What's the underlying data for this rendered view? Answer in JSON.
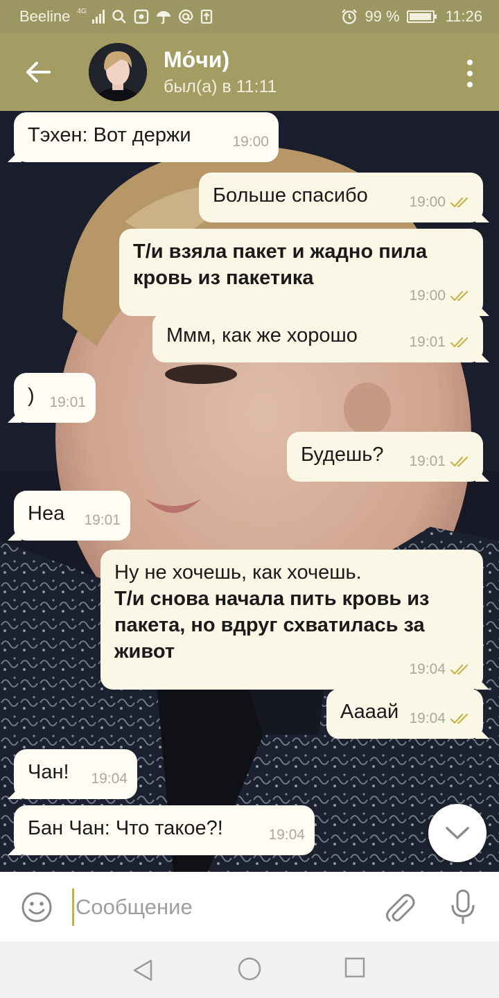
{
  "status_bar": {
    "carrier": "Beeline",
    "network": "4G",
    "battery": "99 %",
    "battery_level": 0.99,
    "time": "11:26"
  },
  "header": {
    "contact_name": "Мо́чи)",
    "last_seen": "был(а) в 11:11"
  },
  "messages": [
    {
      "dir": "in",
      "lines": [
        {
          "text": "Тэхен: Вот держи",
          "bold": false
        }
      ],
      "time": "19:00"
    },
    {
      "dir": "out",
      "lines": [
        {
          "text": "Больше спасибо",
          "bold": false
        }
      ],
      "time": "19:00",
      "read": true
    },
    {
      "dir": "out",
      "lines": [
        {
          "text": "Т/и взяла пакет и жадно пила",
          "bold": true
        },
        {
          "text": "кровь из пакетика",
          "bold": true
        }
      ],
      "time": "19:00",
      "read": true
    },
    {
      "dir": "out",
      "lines": [
        {
          "text": "Ммм, как же хорошо",
          "bold": false
        }
      ],
      "time": "19:01",
      "read": true
    },
    {
      "dir": "in",
      "lines": [
        {
          "text": ")",
          "bold": false
        }
      ],
      "time": "19:01"
    },
    {
      "dir": "out",
      "lines": [
        {
          "text": "Будешь?",
          "bold": false
        }
      ],
      "time": "19:01",
      "read": true
    },
    {
      "dir": "in",
      "lines": [
        {
          "text": "Неа",
          "bold": false
        }
      ],
      "time": "19:01"
    },
    {
      "dir": "out",
      "lines": [
        {
          "text": "Ну не хочешь, как хочешь.",
          "bold": false
        },
        {
          "text": "Т/и снова начала пить кровь из",
          "bold": true
        },
        {
          "text": "пакета, но вдруг схватилась за",
          "bold": true
        },
        {
          "text": "живот",
          "bold": true
        }
      ],
      "time": "19:04",
      "read": true
    },
    {
      "dir": "out",
      "lines": [
        {
          "text": "Аааай",
          "bold": false
        }
      ],
      "time": "19:04",
      "read": true
    },
    {
      "dir": "in",
      "lines": [
        {
          "text": "Чан!",
          "bold": false
        }
      ],
      "time": "19:04"
    },
    {
      "dir": "in",
      "lines": [
        {
          "text": "Бан Чан: Что такое?!",
          "bold": false
        }
      ],
      "time": "19:04"
    }
  ],
  "input": {
    "placeholder": "Сообщение",
    "value": ""
  },
  "icons": {
    "back": "arrow-left-icon",
    "menu": "more-vertical-icon",
    "emoji": "smiley-icon",
    "attach": "paperclip-icon",
    "mic": "microphone-icon",
    "scroll_down": "chevron-down-icon"
  },
  "colors": {
    "header": "#a39d64",
    "status_bar": "#9c9762",
    "bubble": "#fffdf3",
    "check": "#c7b347"
  }
}
